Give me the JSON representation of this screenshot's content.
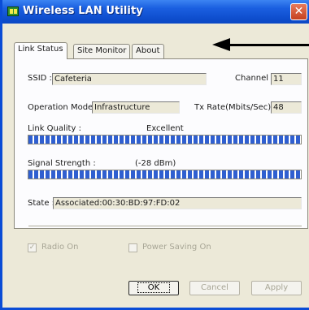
{
  "window": {
    "title": "Wireless LAN Utility",
    "close_glyph": "✕"
  },
  "tabs": [
    {
      "label": "Link Status"
    },
    {
      "label": "Site Monitor"
    },
    {
      "label": "About"
    }
  ],
  "fields": {
    "ssid_label": "SSID :",
    "ssid_value": "Cafeteria",
    "channel_label": "Channel :",
    "channel_value": "11",
    "mode_label": "Operation Mode :",
    "mode_value": "Infrastructure",
    "txrate_label": "Tx Rate(Mbits/Sec) :",
    "txrate_value": "48",
    "link_quality_label": "Link Quality :",
    "link_quality_value": "Excellent",
    "signal_label": "Signal Strength :",
    "signal_value": "(-28 dBm)",
    "state_label": "State :",
    "state_value": "Associated:00:30:BD:97:FD:02"
  },
  "levels": {
    "link_quality": 1.0,
    "signal_strength": 1.0
  },
  "options": {
    "radio_on": {
      "label": "Radio On",
      "checked": true,
      "glyph": "✓"
    },
    "power_saving": {
      "label": "Power Saving On",
      "checked": false
    }
  },
  "buttons": {
    "ok": "OK",
    "cancel": "Cancel",
    "apply": "Apply"
  },
  "icons": {
    "app": "wireless-app-icon",
    "close": "close-icon",
    "pointer": "arrow-left-icon"
  },
  "colors": {
    "titlebar": "#1a5fe0",
    "bar_fill": "#2f5fd0",
    "close": "#c5401e",
    "face": "#ece9d8"
  }
}
